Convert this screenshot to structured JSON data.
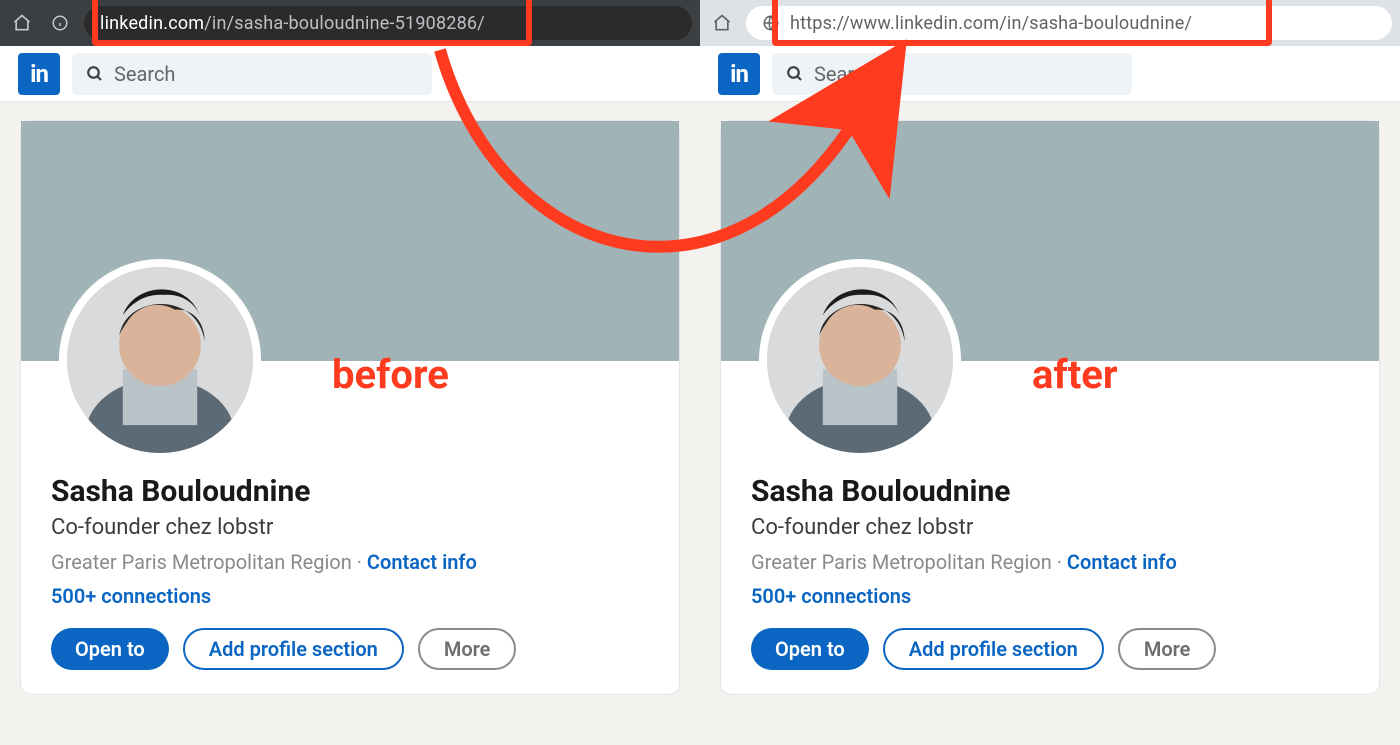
{
  "left": {
    "url_host": "linkedin.com",
    "url_path": "/in/sasha-bouloudnine-51908286/",
    "search_placeholder": "Search",
    "logo": "in",
    "annotation": "before",
    "profile": {
      "name": "Sasha Bouloudnine",
      "tagline": "Co-founder chez lobstr",
      "location": "Greater Paris Metropolitan Region",
      "contact_label": "Contact info",
      "connections": "500+ connections",
      "buttons": {
        "open": "Open to",
        "add": "Add profile section",
        "more": "More"
      }
    }
  },
  "right": {
    "url_full": "https://www.linkedin.com/in/sasha-bouloudnine/",
    "search_placeholder": "Search",
    "logo": "in",
    "annotation": "after",
    "profile": {
      "name": "Sasha Bouloudnine",
      "tagline": "Co-founder chez lobstr",
      "location": "Greater Paris Metropolitan Region",
      "contact_label": "Contact info",
      "connections": "500+ connections",
      "buttons": {
        "open": "Open to",
        "add": "Add profile section",
        "more": "More"
      }
    }
  }
}
